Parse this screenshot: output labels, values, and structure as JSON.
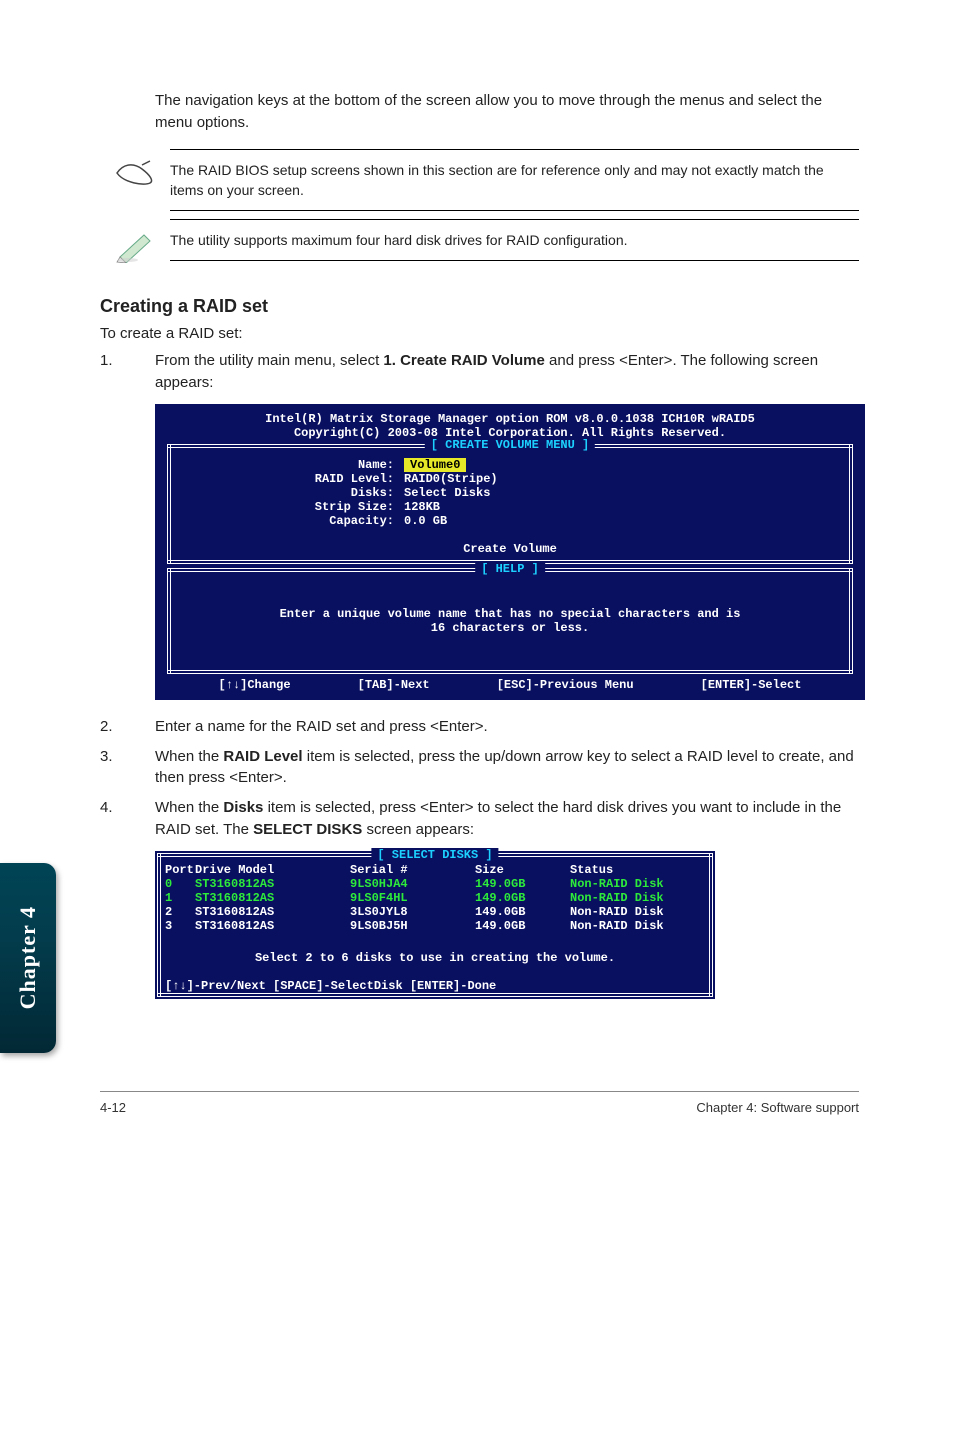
{
  "intro": "The navigation keys at the bottom of the screen allow you to move through the menus and select the menu options.",
  "notes": {
    "note1": "The RAID BIOS setup screens shown in this section are for reference only and may not exactly match the items on your screen.",
    "note2": "The utility supports maximum four hard disk drives for RAID configuration."
  },
  "heading": "Creating a RAID set",
  "heading_sub": "To create a RAID set:",
  "steps": {
    "s1_num": "1.",
    "s1a": "From the utility main menu, select ",
    "s1b_bold": "1. Create RAID Volume",
    "s1c": " and press <Enter>. The following screen appears:",
    "s2_num": "2.",
    "s2": "Enter a name for the RAID set and press <Enter>.",
    "s3_num": "3.",
    "s3a": "When the ",
    "s3b_bold": "RAID Level",
    "s3c": " item is selected, press the up/down arrow key to select a RAID level to create, and then press <Enter>.",
    "s4_num": "4.",
    "s4a": "When the ",
    "s4b_bold": "Disks",
    "s4c": " item is selected, press <Enter> to select the hard disk drives you want to include in the RAID set. The ",
    "s4d_bold": "SELECT DISKS",
    "s4e": " screen appears:"
  },
  "bios": {
    "title1": "Intel(R) Matrix Storage Manager option ROM v8.0.0.1038 ICH10R wRAID5",
    "title2": "Copyright(C) 2003-08 Intel Corporation.  All Rights Reserved.",
    "box1_label": "[ CREATE VOLUME MENU ]",
    "fields": {
      "name_k": "Name:",
      "name_v": "Volume0",
      "raid_k": "RAID Level:",
      "raid_v": "RAID0(Stripe)",
      "disks_k": "Disks:",
      "disks_v": "Select Disks",
      "strip_k": "Strip Size:",
      "strip_v": "128KB",
      "cap_k": "Capacity:",
      "cap_v": "0.0   GB",
      "create": "Create Volume"
    },
    "box2_label": "[ HELP ]",
    "help_line1": "Enter a unique volume name that has no special characters and is",
    "help_line2": "16 characters or less.",
    "nav": {
      "a": "[↑↓]Change",
      "b": "[TAB]-Next",
      "c": "[ESC]-Previous Menu",
      "d": "[ENTER]-Select"
    }
  },
  "select_disks": {
    "label": "[ SELECT DISKS ]",
    "hdr": {
      "port": "Port",
      "model": "Drive Model",
      "serial": "Serial #",
      "size": "Size",
      "status": "Status"
    },
    "rows": [
      {
        "port": "0",
        "model": "ST3160812AS",
        "serial": "9LS0HJA4",
        "size": "149.0GB",
        "status": "Non-RAID Disk"
      },
      {
        "port": "1",
        "model": "ST3160812AS",
        "serial": "9LS0F4HL",
        "size": "149.0GB",
        "status": "Non-RAID Disk"
      },
      {
        "port": "2",
        "model": "ST3160812AS",
        "serial": "3LS0JYL8",
        "size": "149.0GB",
        "status": "Non-RAID Disk"
      },
      {
        "port": "3",
        "model": "ST3160812AS",
        "serial": "9LS0BJ5H",
        "size": "149.0GB",
        "status": "Non-RAID Disk"
      }
    ],
    "help": "Select 2 to 6 disks to use in creating the volume.",
    "nav": "[↑↓]-Prev/Next [SPACE]-SelectDisk [ENTER]-Done"
  },
  "side_tab": "Chapter 4",
  "footer": {
    "left": "4-12",
    "right": "Chapter 4: Software support"
  }
}
